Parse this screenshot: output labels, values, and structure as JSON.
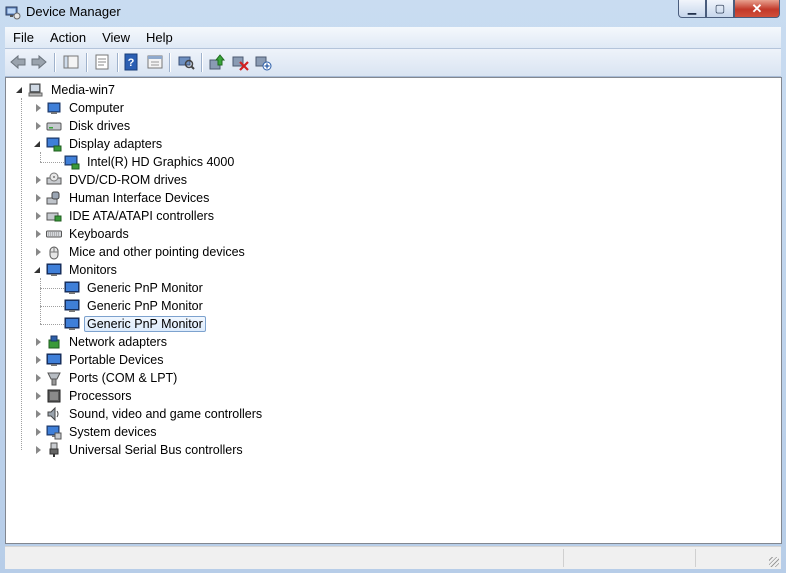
{
  "window": {
    "title": "Device Manager",
    "app_icon": "device-manager-icon"
  },
  "caption_buttons": [
    "minimize",
    "maximize",
    "close"
  ],
  "menu": [
    "File",
    "Action",
    "View",
    "Help"
  ],
  "toolbar": [
    "back",
    "forward",
    "up-one-level",
    "properties",
    "help",
    "show-hide-console-tree",
    "scan-hardware-changes",
    "update-driver",
    "disable-device",
    "uninstall-device"
  ],
  "tree": {
    "root": "Media-win7",
    "categories": [
      {
        "label": "Computer",
        "icon": "computer-icon",
        "expanded": false
      },
      {
        "label": "Disk drives",
        "icon": "disk-drive-icon",
        "expanded": false
      },
      {
        "label": "Display adapters",
        "icon": "display-adapter-icon",
        "expanded": true,
        "children": [
          "Intel(R) HD Graphics 4000"
        ]
      },
      {
        "label": "DVD/CD-ROM drives",
        "icon": "dvd-drive-icon",
        "expanded": false
      },
      {
        "label": "Human Interface Devices",
        "icon": "hid-icon",
        "expanded": false
      },
      {
        "label": "IDE ATA/ATAPI controllers",
        "icon": "ide-controller-icon",
        "expanded": false
      },
      {
        "label": "Keyboards",
        "icon": "keyboard-icon",
        "expanded": false
      },
      {
        "label": "Mice and other pointing devices",
        "icon": "mouse-icon",
        "expanded": false
      },
      {
        "label": "Monitors",
        "icon": "monitor-icon",
        "expanded": true,
        "children": [
          "Generic PnP Monitor",
          "Generic PnP Monitor",
          "Generic PnP Monitor"
        ]
      },
      {
        "label": "Network adapters",
        "icon": "network-adapter-icon",
        "expanded": false
      },
      {
        "label": "Portable Devices",
        "icon": "portable-device-icon",
        "expanded": false
      },
      {
        "label": "Ports (COM & LPT)",
        "icon": "port-icon",
        "expanded": false
      },
      {
        "label": "Processors",
        "icon": "processor-icon",
        "expanded": false
      },
      {
        "label": "Sound, video and game controllers",
        "icon": "sound-icon",
        "expanded": false
      },
      {
        "label": "System devices",
        "icon": "system-device-icon",
        "expanded": false
      },
      {
        "label": "Universal Serial Bus controllers",
        "icon": "usb-icon",
        "expanded": false
      }
    ],
    "selected": "Generic PnP Monitor"
  },
  "colors": {
    "selection_border": "#7da2ce",
    "selection_fill": "#dcebfc",
    "close_button": "#c2392a"
  }
}
